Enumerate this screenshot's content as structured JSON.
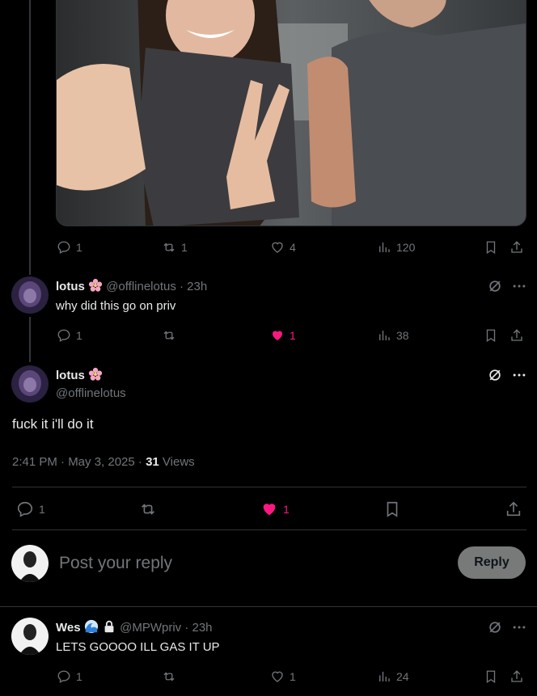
{
  "thread": {
    "photo_post": {
      "actions": {
        "replies": "1",
        "reposts": "1",
        "likes": "4",
        "views": "120"
      }
    },
    "reply1": {
      "display_name": "lotus",
      "handle_time": "@offlinelotus · 23h",
      "text": "why did this go on priv",
      "actions": {
        "replies": "1",
        "reposts": "",
        "likes": "1",
        "views": "38"
      }
    },
    "main_post": {
      "display_name": "lotus",
      "handle": "@offlinelotus",
      "text": "fuck it i'll do it",
      "timestamp": "2:41 PM · May 3, 2025 · ",
      "view_count": "31",
      "views_label": " Views",
      "actions": {
        "replies": "1",
        "reposts": "",
        "likes": "1"
      }
    }
  },
  "composer": {
    "placeholder": "Post your reply",
    "reply_label": "Reply"
  },
  "reply_wes": {
    "display_name": "Wes",
    "handle_time": "@MPWpriv · 23h",
    "text": "LETS GOOOO ILL GAS IT UP",
    "actions": {
      "replies": "1",
      "reposts": "",
      "likes": "1",
      "views": "24"
    }
  },
  "colors": {
    "like": "#f91880",
    "muted": "#71767b",
    "text": "#e7e9ea",
    "divider": "#2f3336"
  }
}
